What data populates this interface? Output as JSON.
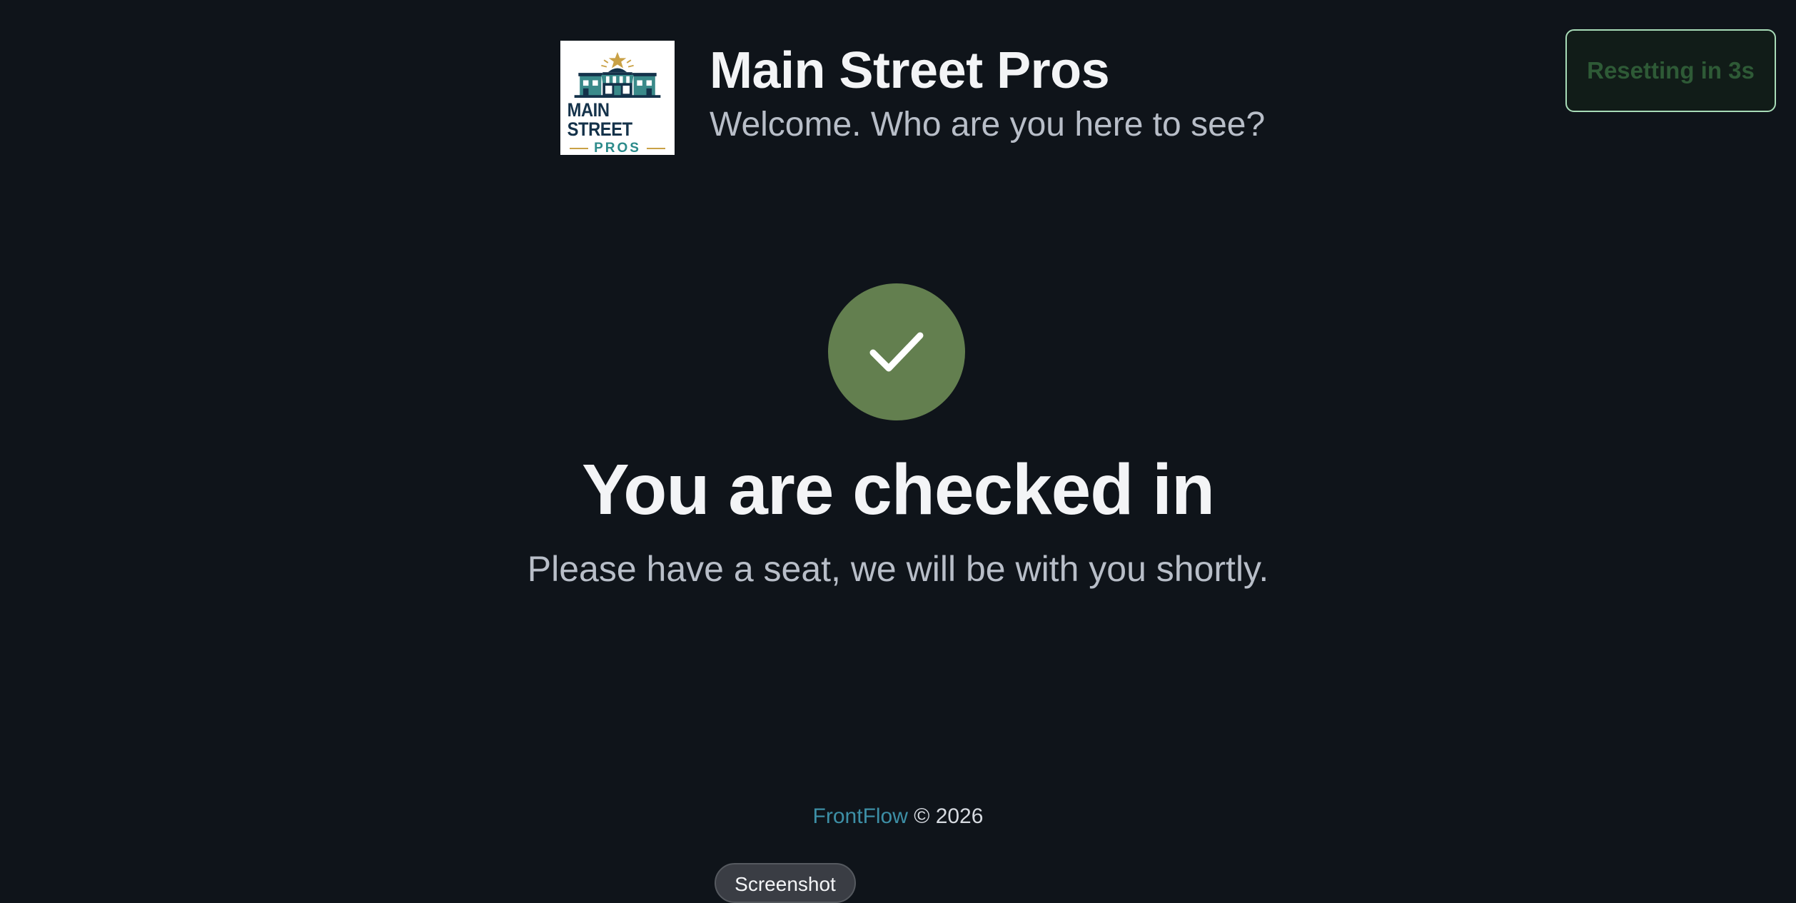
{
  "header": {
    "app_title": "Main Street Pros",
    "subtitle": "Welcome. Who are you here to see?",
    "logo": {
      "icon": "storefront-logo",
      "text_main": "MAIN STREET",
      "text_sub": "PROS"
    }
  },
  "reset_button": {
    "label": "Resetting in 3s"
  },
  "status": {
    "icon": "checkmark-icon",
    "heading": "You are checked in",
    "message": "Please have a seat, we will be with you shortly."
  },
  "footer": {
    "brand": "FrontFlow",
    "copyright": "© 2026"
  },
  "screenshot_button": {
    "label": "Screenshot"
  },
  "colors": {
    "background": "#0f141a",
    "success": "#637f4f",
    "brand_link": "#3d8fa6",
    "reset_border": "#a8dcb8",
    "reset_text": "#2e5a36"
  }
}
